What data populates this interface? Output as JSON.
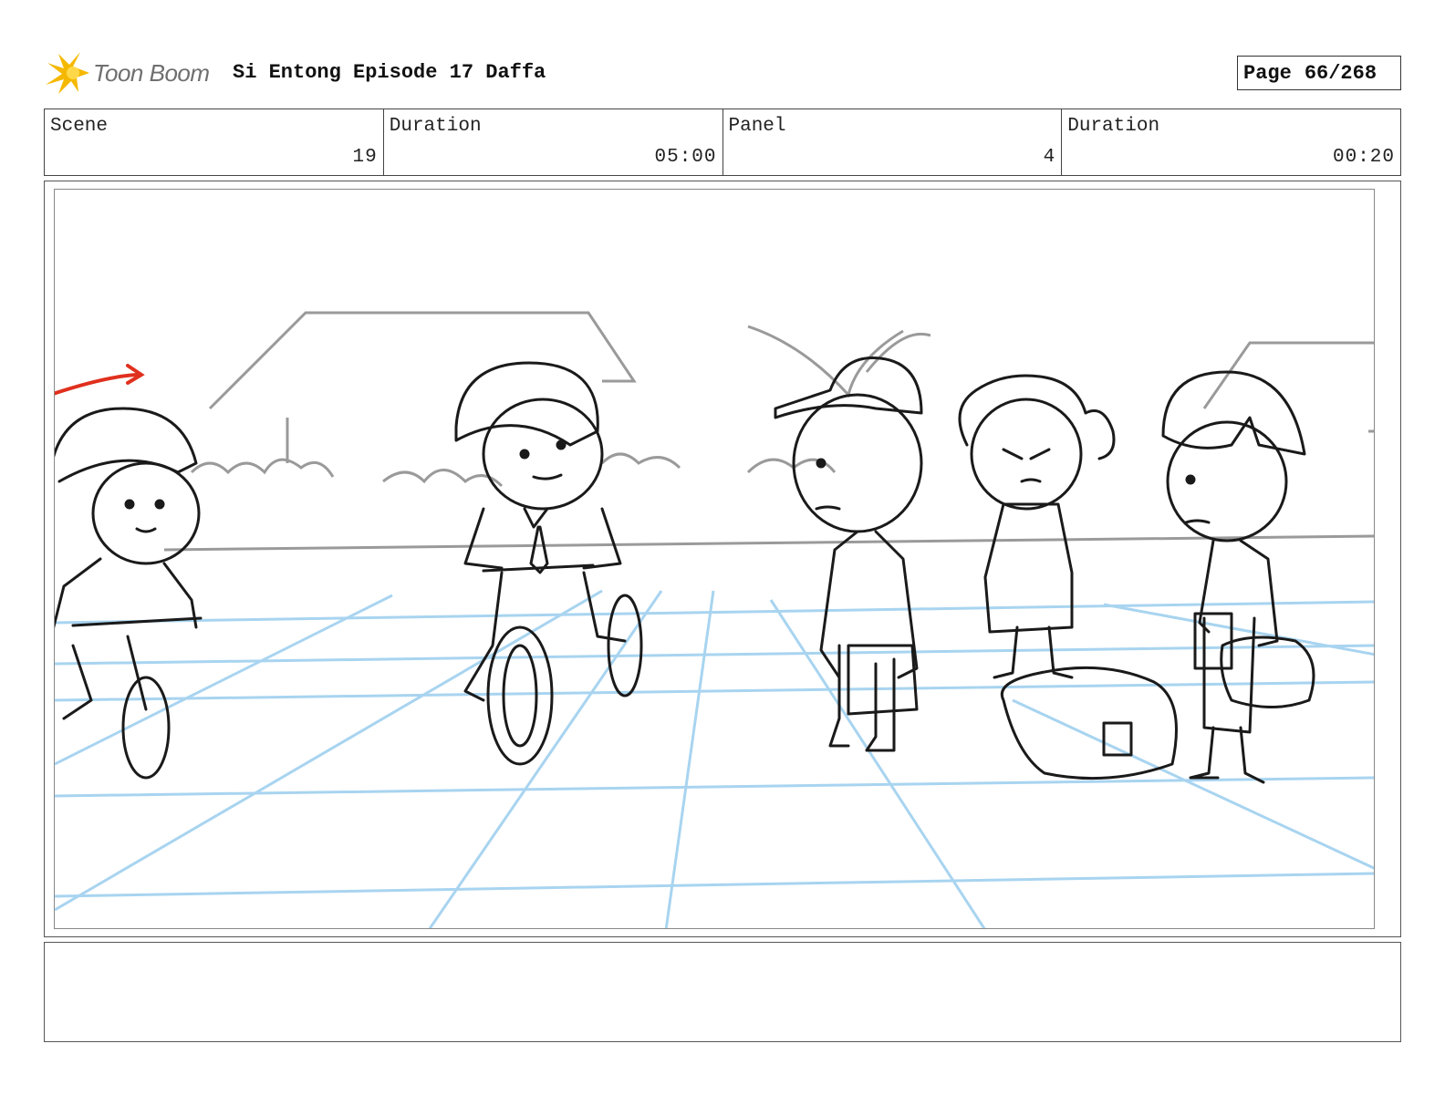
{
  "header": {
    "logo_text": "Toon Boom",
    "title": "Si Entong Episode 17 Daffa",
    "page_label": "Page",
    "page_value": "66/268"
  },
  "info": {
    "scene_label": "Scene",
    "scene_value": "19",
    "scene_duration_label": "Duration",
    "scene_duration_value": "05:00",
    "panel_label": "Panel",
    "panel_value": "4",
    "panel_duration_label": "Duration",
    "panel_duration_value": "00:20"
  },
  "colors": {
    "sketch": "#1a1a1a",
    "background_sketch": "#9a9a9a",
    "perspective_grid": "#a8d4f0",
    "arrow": "#e0301e",
    "logo_accent": "#f5b800"
  }
}
